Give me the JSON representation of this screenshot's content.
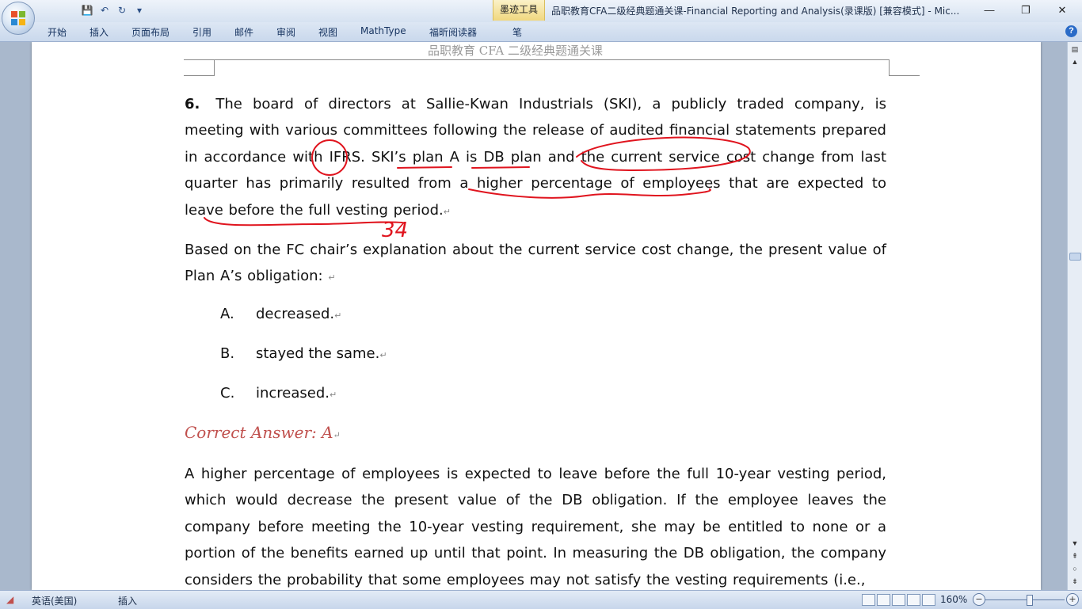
{
  "window": {
    "contextual_tab": "墨迹工具",
    "title": "品职教育CFA二级经典题通关课-Financial Reporting and Analysis(录课版) [兼容模式] - Mic...",
    "minimize": "—",
    "restore": "❐",
    "close": "✕"
  },
  "quick_access": [
    "save-icon",
    "undo-icon",
    "redo-icon",
    "customize-icon"
  ],
  "ribbon": {
    "tabs": [
      "开始",
      "插入",
      "页面布局",
      "引用",
      "邮件",
      "审阅",
      "视图",
      "MathType",
      "福昕阅读器",
      "笔"
    ],
    "help": "?"
  },
  "document": {
    "header": "品职教育 CFA 二级经典题通关课",
    "question_number": "6.",
    "question_text": "The board of directors at Sallie-Kwan Industrials (SKI), a publicly traded company, is meeting with various committees following the release of audited financial statements prepared in accordance with IFRS. SKI’s plan A is DB plan and the current service cost change from last quarter has primarily resulted from a higher percentage of employees that are expected to leave before the full vesting period.",
    "prompt": "Based on the FC chair’s explanation about the current service cost change, the present value of Plan A’s obligation:",
    "options": [
      {
        "letter": "A.",
        "text": "decreased."
      },
      {
        "letter": "B.",
        "text": "stayed the same."
      },
      {
        "letter": "C.",
        "text": "increased."
      }
    ],
    "correct_answer": "Correct Answer: A",
    "explanation": "A higher percentage of employees is expected to leave before the full 10-year vesting period, which would decrease the present value of the DB obligation. If the employee leaves the company before meeting the 10-year vesting requirement, she may be entitled to none or a portion of the benefits earned up until that point. In measuring the DB obligation, the company considers the probability that some employees may not satisfy the vesting requirements (i.e.,",
    "paragraph_mark": "↵",
    "handwriting": "34"
  },
  "status_bar": {
    "language": "英语(美国)",
    "insert_mode": "插入",
    "zoom": "160%",
    "zoom_out": "−",
    "zoom_in": "+"
  },
  "colors": {
    "ink": "#e0141e",
    "accent": "#c0504d"
  }
}
